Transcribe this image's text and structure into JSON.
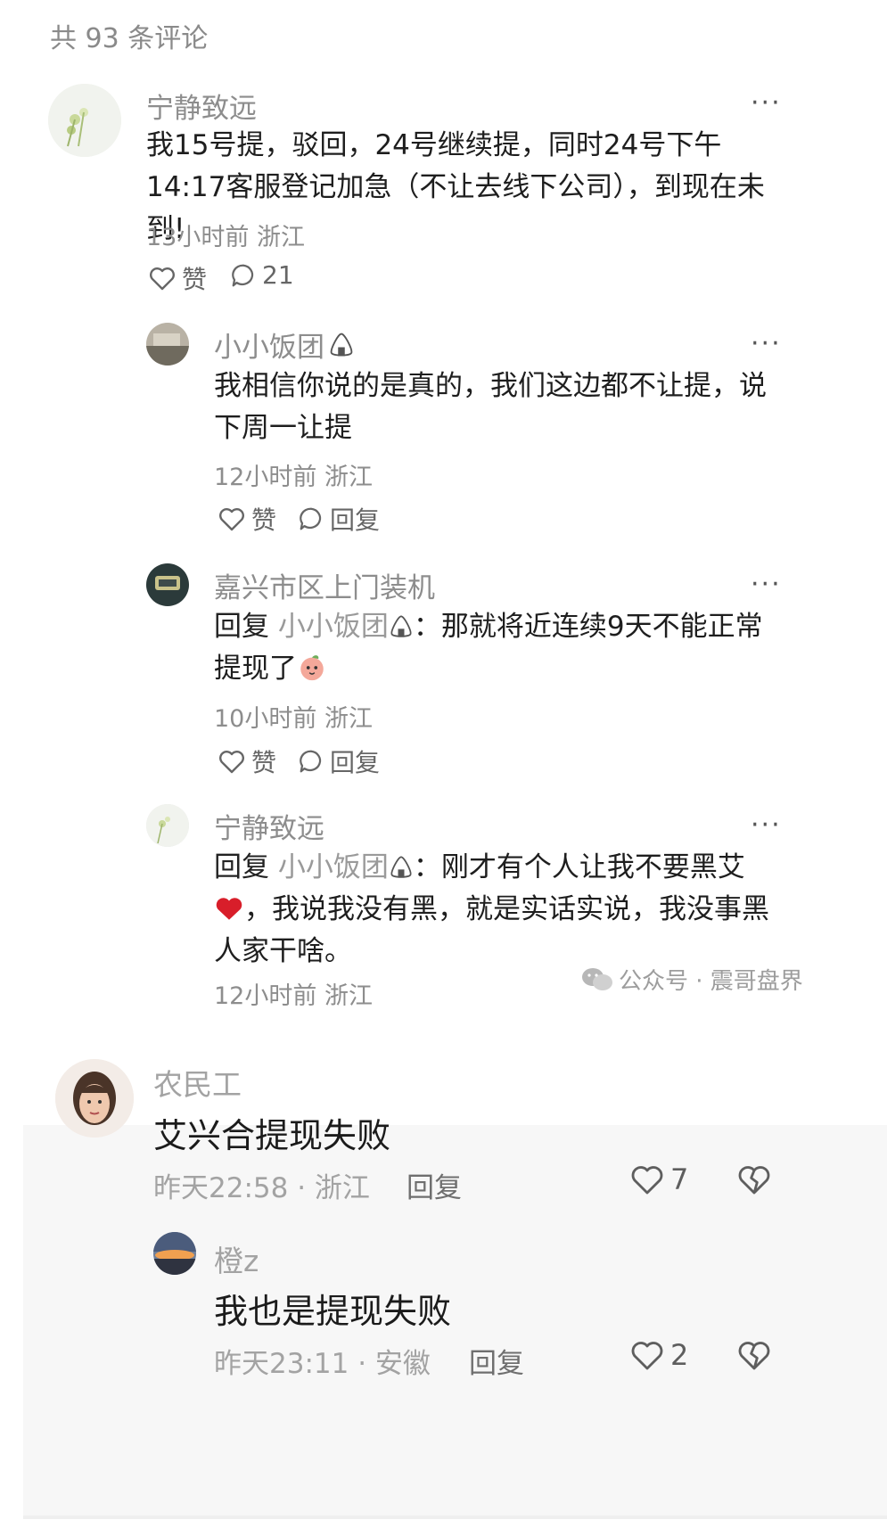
{
  "header": {
    "comment_count": "共 93 条评论"
  },
  "comments": [
    {
      "username": "宁静致远",
      "text": "我15号提，驳回，24号继续提，同时24号下午14:17客服登记加急（不让去线下公司），到现在未到!",
      "time_loc": "13小时前 浙江",
      "like_label": "赞",
      "reply_count": "21",
      "replies": [
        {
          "username": "小小饭团",
          "text": "我相信你说的是真的，我们这边都不让提，说下周一让提",
          "time_loc": "12小时前 浙江",
          "like_label": "赞",
          "reply_label": "回复"
        },
        {
          "username": "嘉兴市区上门装机",
          "reply_prefix": "回复",
          "reply_to": "小小饭团",
          "text": "：那就将近连续9天不能正常提现了",
          "time_loc": "10小时前 浙江",
          "like_label": "赞",
          "reply_label": "回复"
        },
        {
          "username": "宁静致远",
          "reply_prefix": "回复",
          "reply_to": "小小饭团",
          "text": "：刚才有个人让我不要黑艾",
          "text2": "，我说我没有黑，就是实话实说，我没事黑人家干啥。",
          "time_loc": "12小时前 浙江"
        }
      ]
    },
    {
      "username": "农民工",
      "text": "艾兴合提现失败",
      "time_loc": "昨天22:58 · 浙江",
      "reply_label": "回复",
      "like_count": "7",
      "replies": [
        {
          "username": "橙z",
          "text": "我也是提现失败",
          "time_loc": "昨天23:11 · 安徽",
          "reply_label": "回复",
          "like_count": "2"
        }
      ]
    }
  ],
  "watermark": "公众号 · 震哥盘界",
  "colors": {
    "heart": "#d81e2a",
    "text_primary": "#1e1e1e",
    "text_meta": "#8d8d8d"
  }
}
